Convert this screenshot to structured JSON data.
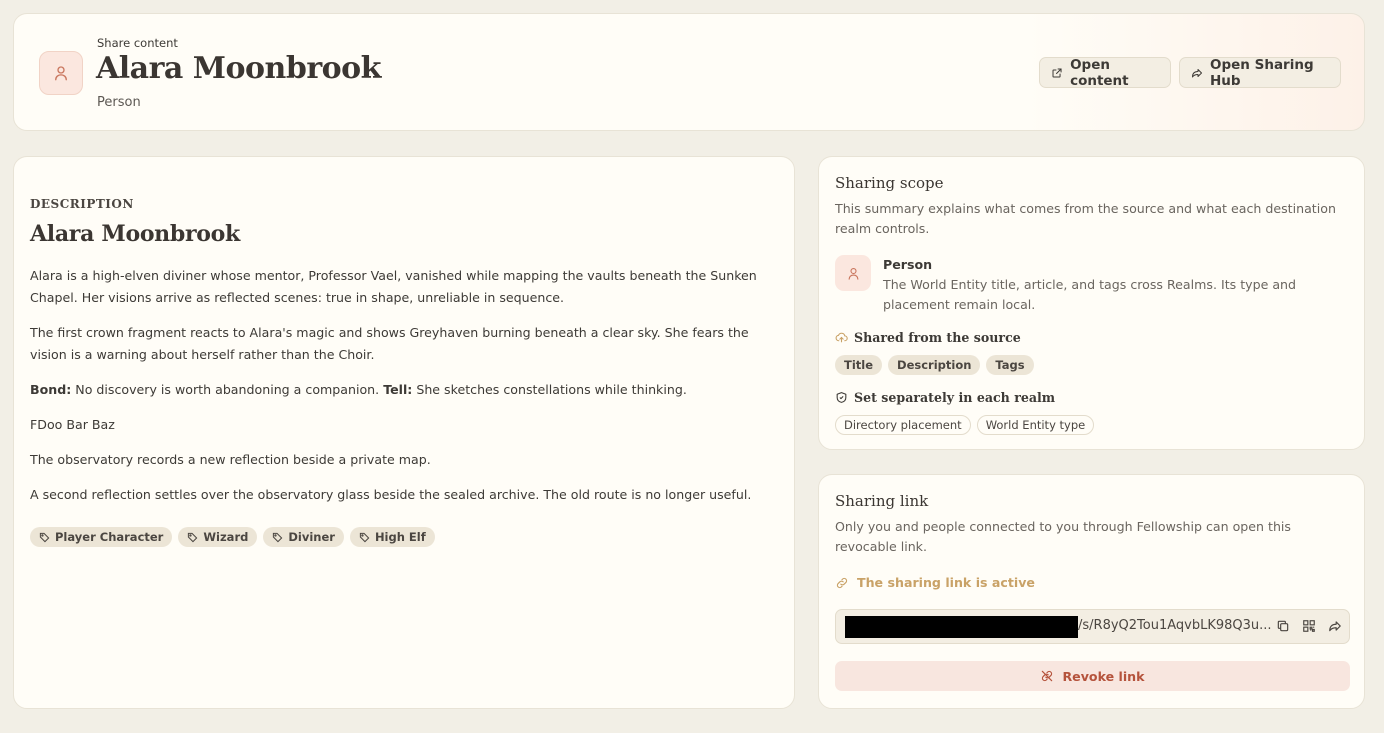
{
  "header": {
    "eyebrow": "Share content",
    "title": "Alara Moonbrook",
    "subtitle": "Person",
    "open_content_label": "Open content",
    "open_hub_label": "Open Sharing Hub"
  },
  "description": {
    "section_label": "DESCRIPTION",
    "title": "Alara Moonbrook",
    "paragraphs": [
      "Alara is a high-elven diviner whose mentor, Professor Vael, vanished while mapping the vaults beneath the Sunken Chapel. Her visions arrive as reflected scenes: true in shape, unreliable in sequence.",
      "The first crown fragment reacts to Alara's magic and shows Greyhaven burning beneath a clear sky. She fears the vision is a warning about herself rather than the Choir."
    ],
    "bond_label": "Bond:",
    "bond_text": " No discovery is worth abandoning a companion. ",
    "tell_label": "Tell:",
    "tell_text": " She sketches constellations while thinking.",
    "extra_paragraphs": [
      "FDoo Bar Baz",
      "The observatory records a new reflection beside a private map.",
      "A second reflection settles over the observatory glass beside the sealed archive. The old route is no longer useful."
    ],
    "tags": [
      "Player Character",
      "Wizard",
      "Diviner",
      "High Elf"
    ]
  },
  "scope": {
    "title": "Sharing scope",
    "desc": "This summary explains what comes from the source and what each destination realm controls.",
    "person_name": "Person",
    "person_desc": "The World Entity title, article, and tags cross Realms. Its type and placement remain local.",
    "shared_head": "Shared from the source",
    "shared_chips": [
      "Title",
      "Description",
      "Tags"
    ],
    "local_head": "Set separately in each realm",
    "local_chips": [
      "Directory placement",
      "World Entity type"
    ]
  },
  "link": {
    "title": "Sharing link",
    "desc": "Only you and people connected to you through Fellowship can open this revocable link.",
    "status": "The sharing link is active",
    "url_visible": "/s/R8yQ2Tou1AqvbLK98Q3u...",
    "revoke_label": "Revoke link"
  },
  "colors": {
    "accent": "#c9a267",
    "danger": "#b5533c",
    "avatar_bg": "#fbe7df",
    "page_bg": "#f2efe6"
  }
}
